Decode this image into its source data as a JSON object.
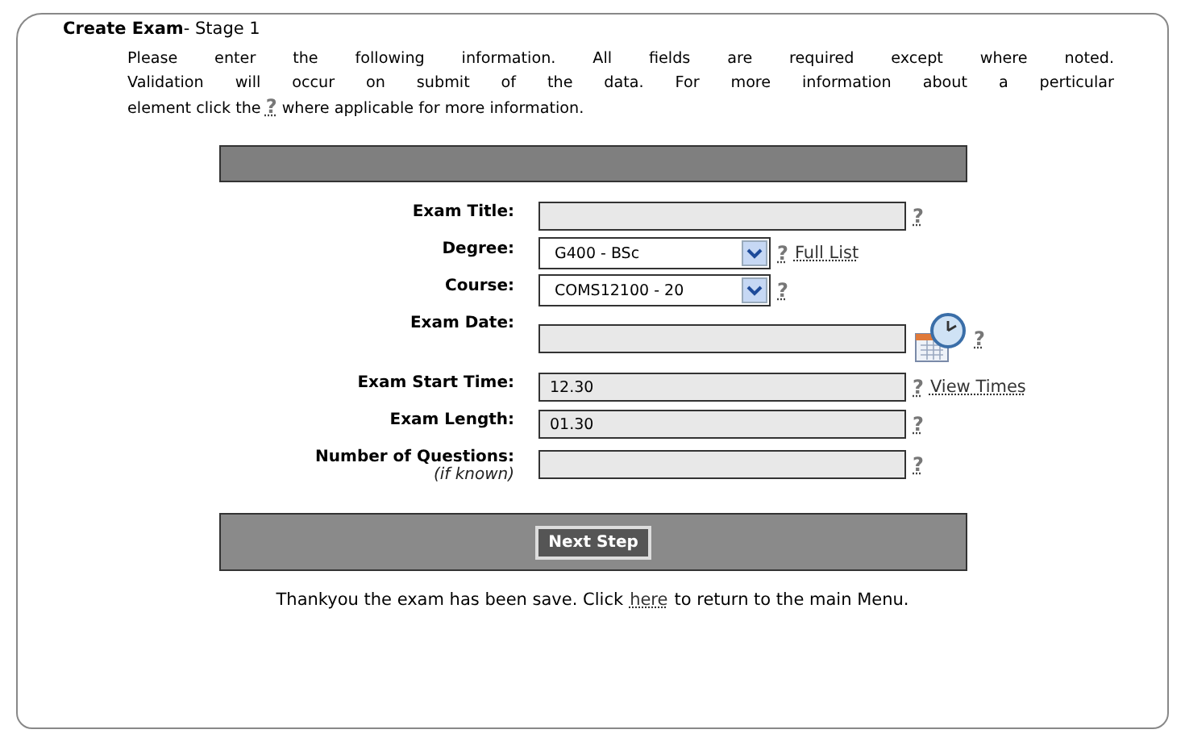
{
  "panel": {
    "title": "Create Exam",
    "subtitle": "- Stage 1"
  },
  "intro": {
    "lines": [
      "Please enter the following information. All fields are required except where noted.",
      "Validation will occur on submit of the data. For more information about a perticular"
    ],
    "before": "element click the",
    "help": "?",
    "after": "where applicable for more information."
  },
  "fields": [
    {
      "kind": "text",
      "label": "Exam Title:",
      "help": "?"
    },
    {
      "kind": "select",
      "label": "Degree:",
      "value": "G400 - BSc",
      "help": "?",
      "link": "Full List"
    },
    {
      "kind": "select",
      "label": "Course:",
      "value": "COMS12100 - 20",
      "help": "?"
    },
    {
      "kind": "date",
      "label": "Exam Date:",
      "help": "?"
    },
    {
      "kind": "text",
      "label": "Exam Start Time:",
      "value": "12.30",
      "help": "?",
      "link": "View Times"
    },
    {
      "kind": "text",
      "label": "Exam Length:",
      "value": "01.30",
      "help": "?"
    },
    {
      "kind": "text",
      "label": "Number of Questions:",
      "note": "(if known)",
      "help": "?"
    }
  ],
  "next_button": "Next Step",
  "footer": {
    "before": "Thankyou the exam has been save. Click",
    "link": "here",
    "after": "to return to the main Menu."
  }
}
